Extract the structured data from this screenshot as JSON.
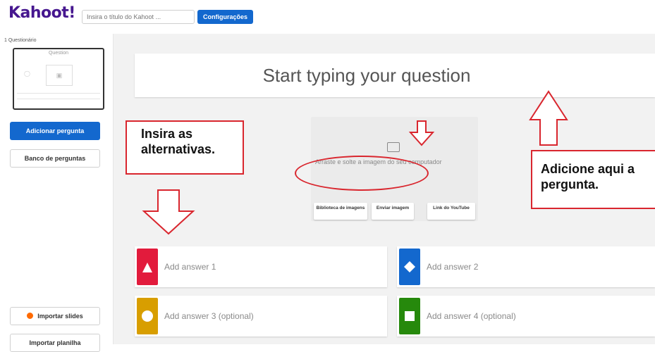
{
  "header": {
    "logo": "Kahoot!",
    "title_placeholder": "Insira o título do Kahoot ...",
    "config_label": "Configurações"
  },
  "sidebar": {
    "section_label": "1 Questionário",
    "thumb_title": "Question",
    "add_question": "Adicionar pergunta",
    "question_bank": "Banco de perguntas",
    "import_slides": "Importar slides",
    "import_sheet": "Importar planilha"
  },
  "question": {
    "placeholder": "Start typing your question"
  },
  "media": {
    "drop_text": "Arraste e solte a imagem do seu computador",
    "buttons": [
      "Biblioteca de imagens",
      "Enviar imagem",
      "Link do YouTube"
    ]
  },
  "answers": [
    {
      "text": "Add answer 1",
      "color": "#e21b3c",
      "shape": "triangle"
    },
    {
      "text": "Add answer 2",
      "color": "#1368ce",
      "shape": "diamond"
    },
    {
      "text": "Add answer 3 (optional)",
      "color": "#d89e00",
      "shape": "circle"
    },
    {
      "text": "Add answer 4 (optional)",
      "color": "#26890c",
      "shape": "square"
    }
  ],
  "annotations": {
    "alternatives": "Insira as alternativas.",
    "question": "Adicione aqui a pergunta.",
    "color": "#d9262e"
  }
}
